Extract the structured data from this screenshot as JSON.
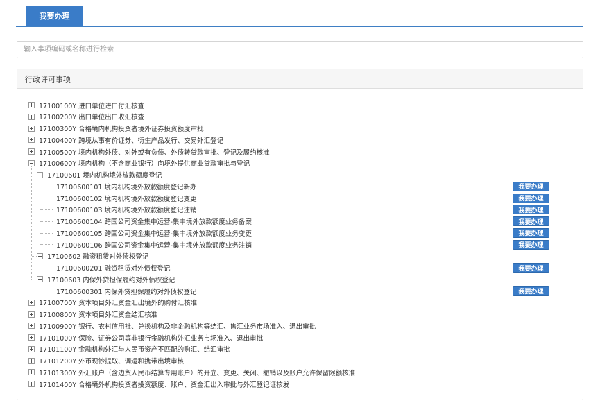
{
  "tab": {
    "label": "我要办理"
  },
  "search": {
    "placeholder": "输入事项编码或名称进行检索"
  },
  "panel": {
    "title": "行政许可事项"
  },
  "action_label": "我要办理",
  "tree": [
    {
      "label": "17100100Y 进口单位进口付汇核查"
    },
    {
      "label": "17100200Y 出口单位出口收汇核查"
    },
    {
      "label": "17100300Y 合格境内机构投资者境外证券投资额度审批"
    },
    {
      "label": "17100400Y 跨境从事有价证券、衍生产品发行、交易外汇登记"
    },
    {
      "label": "17100500Y 境内机构外债、对外或有负债、外债转贷款审批、登记及履约核准"
    },
    {
      "label": "17100600Y 境内机构（不含商业银行）向境外提供商业贷款审批与登记"
    },
    {
      "label": "17100601 境内机构境外放款额度登记"
    },
    {
      "label": "17100600101 境内机构境外放款额度登记新办"
    },
    {
      "label": "17100600102 境内机构境外放款额度登记变更"
    },
    {
      "label": "17100600103 境内机构境外放款额度登记注销"
    },
    {
      "label": "17100600104 跨国公司资金集中运营-集中境外放款额度业务备案"
    },
    {
      "label": "17100600105 跨国公司资金集中运营-集中境外放款额度业务变更"
    },
    {
      "label": "17100600106 跨国公司资金集中运营-集中境外放款额度业务注销"
    },
    {
      "label": "17100602 融资租赁对外债权登记"
    },
    {
      "label": "17100600201 融资租赁对外债权登记"
    },
    {
      "label": "17100603 内保外贷担保履约对外债权登记"
    },
    {
      "label": "17100600301 内保外贷担保履约对外债权登记"
    },
    {
      "label": "17100700Y 资本项目外汇资金汇出境外的购付汇核准"
    },
    {
      "label": "17100800Y 资本项目外汇资金结汇核准"
    },
    {
      "label": "17100900Y 银行、农村信用社、兑换机构及非金融机构等结汇、售汇业务市场准入、退出审批"
    },
    {
      "label": "17101000Y 保险、证券公司等非银行金融机构外汇业务市场准入、退出审批"
    },
    {
      "label": "17101100Y 金融机构外汇与人民币资产不匹配的购汇、结汇审批"
    },
    {
      "label": "17101200Y 外币现钞提取、调运和携带出境审核"
    },
    {
      "label": "17101300Y 外汇账户（含边贸人民币结算专用账户）的开立、变更、关闭、撤销以及账户允许保留限额核准"
    },
    {
      "label": "17101400Y 合格境外机构投资者投资额度、账户、资金汇出入审批与外汇登记证核发"
    }
  ],
  "colors": {
    "primary": "#3a7cc8",
    "border": "#dcdcdc",
    "panel_header_bg": "#f6f6f6"
  }
}
